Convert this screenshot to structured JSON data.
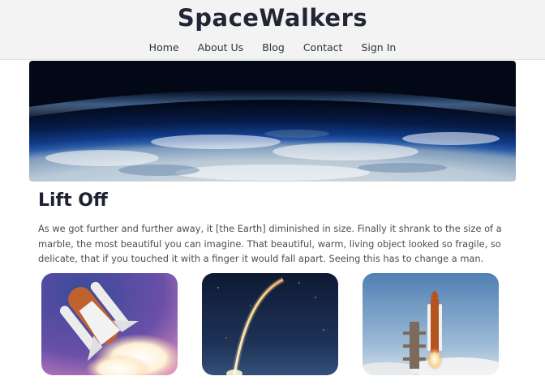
{
  "site": {
    "brand": "SpaceWalkers"
  },
  "nav": {
    "items": [
      {
        "label": "Home"
      },
      {
        "label": "About Us"
      },
      {
        "label": "Blog"
      },
      {
        "label": "Contact"
      },
      {
        "label": "Sign In"
      }
    ]
  },
  "hero": {
    "image_subject": "earth-horizon-from-orbit"
  },
  "article": {
    "title": "Lift Off",
    "body": "As we got further and further away, it [the Earth] diminished in size. Finally it shrank to the size of a marble, the most beautiful you can imagine. That beautiful, warm, living object looked so fragile, so delicate, that if you touched it with a finger it would fall apart. Seeing this has to change a man."
  },
  "gallery": {
    "images": [
      {
        "subject": "space-shuttle-ascent"
      },
      {
        "subject": "rocket-launch-trail-night"
      },
      {
        "subject": "shuttle-on-launch-pad"
      }
    ]
  },
  "colors": {
    "header_bg": "#f3f3f3",
    "brand_text": "#222634",
    "body_text": "#4a4d55"
  }
}
